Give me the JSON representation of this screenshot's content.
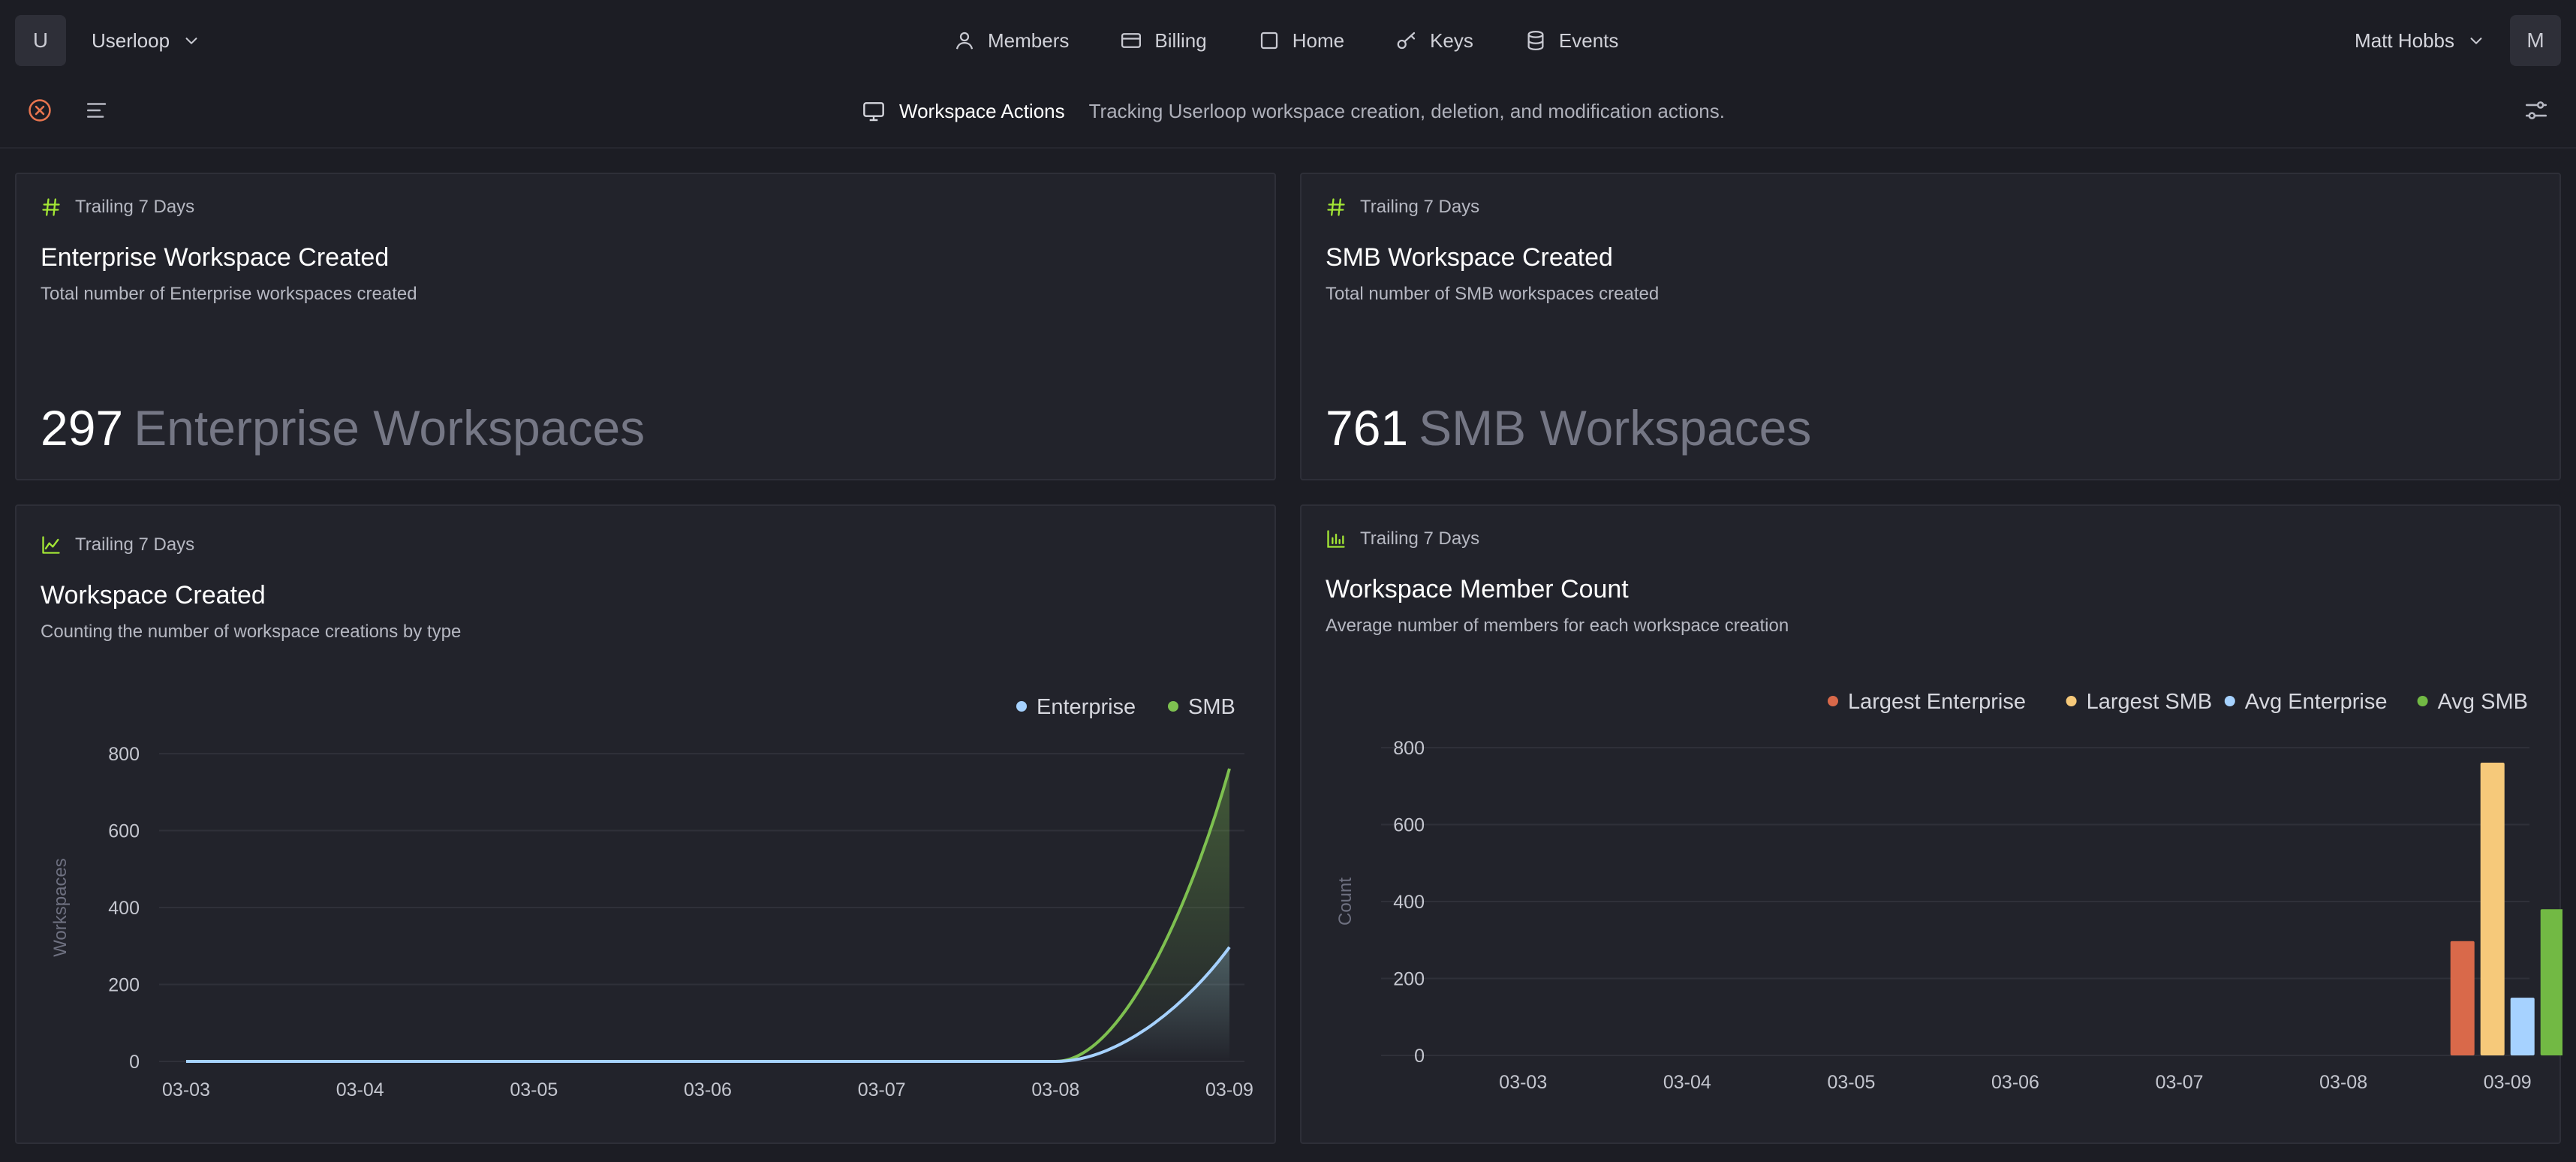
{
  "nav": {
    "workspace_initial": "U",
    "workspace_name": "Userloop",
    "items": [
      {
        "label": "Members",
        "icon": "user-icon"
      },
      {
        "label": "Billing",
        "icon": "credit-card-icon"
      },
      {
        "label": "Home",
        "icon": "square-icon"
      },
      {
        "label": "Keys",
        "icon": "key-icon"
      },
      {
        "label": "Events",
        "icon": "database-icon"
      }
    ],
    "user_name": "Matt Hobbs",
    "user_initial": "M"
  },
  "subheader": {
    "title": "Workspace Actions",
    "description": "Tracking Userloop workspace creation, deletion, and modification actions."
  },
  "colors": {
    "accent": "#a3e635",
    "enterprise": "#a6d2ff",
    "smb": "#7ec050",
    "largest_enterprise": "#d9694a",
    "largest_smb": "#f6c97a",
    "avg_enterprise": "#a6d2ff",
    "avg_smb": "#72b944"
  },
  "cards": {
    "enterprise": {
      "tag": "Trailing 7 Days",
      "title": "Enterprise Workspace Created",
      "subtitle": "Total number of Enterprise workspaces created",
      "value": "297",
      "unit": "Enterprise Workspaces"
    },
    "smb": {
      "tag": "Trailing 7 Days",
      "title": "SMB Workspace Created",
      "subtitle": "Total number of SMB workspaces created",
      "value": "761",
      "unit": "SMB Workspaces"
    },
    "created": {
      "tag": "Trailing 7 Days",
      "title": "Workspace Created",
      "subtitle": "Counting the number of workspace creations by type"
    },
    "members": {
      "tag": "Trailing 7 Days",
      "title": "Workspace Member Count",
      "subtitle": "Average number of members for each workspace creation"
    }
  },
  "chart_data": [
    {
      "type": "area",
      "title": "Workspace Created",
      "categories": [
        "03-03",
        "03-04",
        "03-05",
        "03-06",
        "03-07",
        "03-08",
        "03-09"
      ],
      "series": [
        {
          "name": "Enterprise",
          "values": [
            0,
            0,
            0,
            0,
            0,
            0,
            297
          ]
        },
        {
          "name": "SMB",
          "values": [
            0,
            0,
            0,
            0,
            0,
            0,
            761
          ]
        }
      ],
      "xlabel": "",
      "ylabel": "Workspaces",
      "yticks": [
        0,
        200,
        400,
        600,
        800
      ],
      "ylim": [
        0,
        800
      ],
      "grid": true,
      "legend": "top-right"
    },
    {
      "type": "bar",
      "title": "Workspace Member Count",
      "categories": [
        "03-03",
        "03-04",
        "03-05",
        "03-06",
        "03-07",
        "03-08",
        "03-09"
      ],
      "series": [
        {
          "name": "Largest Enterprise",
          "values": [
            0,
            0,
            0,
            0,
            0,
            0,
            297
          ]
        },
        {
          "name": "Largest SMB",
          "values": [
            0,
            0,
            0,
            0,
            0,
            0,
            761
          ]
        },
        {
          "name": "Avg Enterprise",
          "values": [
            0,
            0,
            0,
            0,
            0,
            0,
            150
          ]
        },
        {
          "name": "Avg SMB",
          "values": [
            0,
            0,
            0,
            0,
            0,
            0,
            380
          ]
        }
      ],
      "xlabel": "",
      "ylabel": "Count",
      "yticks": [
        0,
        200,
        400,
        600,
        800
      ],
      "ylim": [
        0,
        800
      ],
      "grid": true,
      "legend": "top-right"
    }
  ]
}
